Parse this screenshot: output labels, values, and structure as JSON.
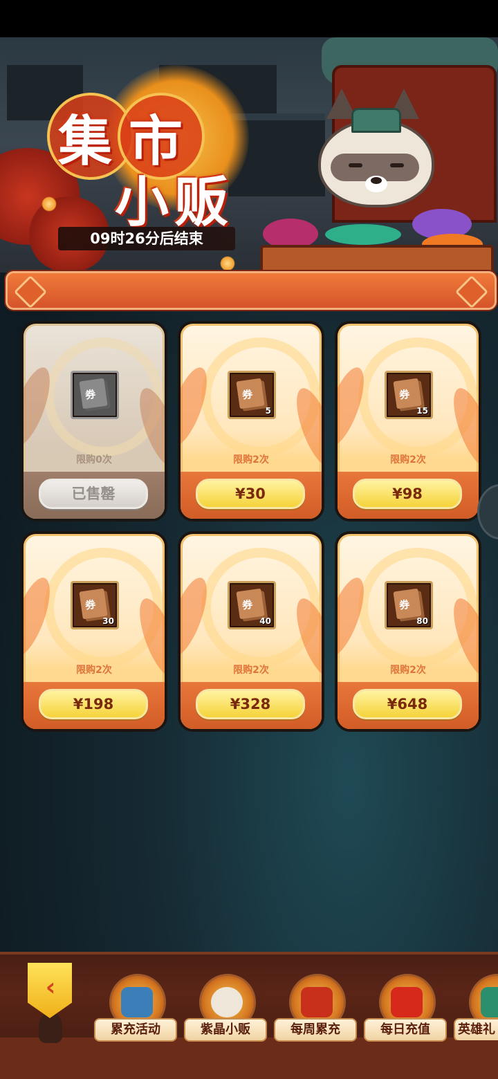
{
  "event": {
    "title_chars": [
      "集",
      "市",
      "小",
      "贩"
    ],
    "countdown": "09时26分后结束"
  },
  "products": [
    {
      "limit": "限购0次",
      "price": "已售罄",
      "ticket_glyph": "券",
      "count": "",
      "sold_out": true
    },
    {
      "limit": "限购2次",
      "price": "¥30",
      "ticket_glyph": "券",
      "count": "5",
      "sold_out": false
    },
    {
      "limit": "限购2次",
      "price": "¥98",
      "ticket_glyph": "券",
      "count": "15",
      "sold_out": false
    },
    {
      "limit": "限购2次",
      "price": "¥198",
      "ticket_glyph": "券",
      "count": "30",
      "sold_out": false
    },
    {
      "limit": "限购2次",
      "price": "¥328",
      "ticket_glyph": "券",
      "count": "40",
      "sold_out": false
    },
    {
      "limit": "限购2次",
      "price": "¥648",
      "ticket_glyph": "券",
      "count": "80",
      "sold_out": false
    }
  ],
  "bottom_nav": {
    "items": [
      {
        "label": "累充活动",
        "icon": "treasure-bag-icon"
      },
      {
        "label": "紫晶小贩",
        "icon": "raccoon-merchant-icon"
      },
      {
        "label": "每周累充",
        "icon": "treasure-chest-icon"
      },
      {
        "label": "每日充值",
        "icon": "red-envelope-icon"
      },
      {
        "label": "英雄礼",
        "icon": "hero-gift-icon"
      }
    ],
    "back_glyph": "‹"
  },
  "colors": {
    "banner": "#e26a32",
    "card_frame": "#f4c16d",
    "price_button": "#f5d33a",
    "sold_out_button": "#d9cfc6"
  }
}
